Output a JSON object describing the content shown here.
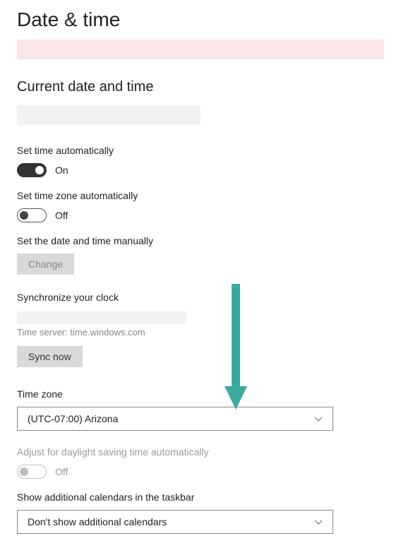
{
  "page": {
    "title": "Date & time"
  },
  "section": {
    "heading": "Current date and time"
  },
  "setTimeAuto": {
    "label": "Set time automatically",
    "state": "On"
  },
  "setTzAuto": {
    "label": "Set time zone automatically",
    "state": "Off"
  },
  "manual": {
    "label": "Set the date and time manually",
    "button": "Change"
  },
  "sync": {
    "heading": "Synchronize your clock",
    "server": "Time server: time.windows.com",
    "button": "Sync now"
  },
  "timezone": {
    "label": "Time zone",
    "selected": "(UTC-07:00) Arizona"
  },
  "dst": {
    "label": "Adjust for daylight saving time automatically",
    "state": "Off"
  },
  "calendars": {
    "label": "Show additional calendars in the taskbar",
    "selected": "Don't show additional calendars"
  }
}
